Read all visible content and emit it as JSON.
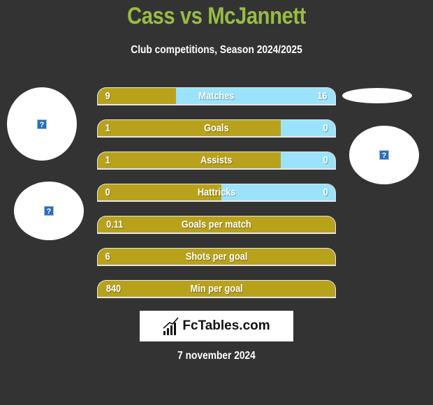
{
  "header": {
    "title": "Cass vs McJannett",
    "subtitle": "Club competitions, Season 2024/2025"
  },
  "colors": {
    "background": "#333333",
    "title": "#99bb44",
    "left_player": "#b8a21c",
    "right_player": "#9be3fb"
  },
  "stats": [
    {
      "label": "Matches",
      "left": "9",
      "right": "16",
      "right_share": 0.67
    },
    {
      "label": "Goals",
      "left": "1",
      "right": "0",
      "right_share": 0.23
    },
    {
      "label": "Assists",
      "left": "1",
      "right": "0",
      "right_share": 0.23
    },
    {
      "label": "Hattricks",
      "left": "0",
      "right": "0",
      "right_share": 0.48
    },
    {
      "label": "Goals per match",
      "left": "0.11",
      "right": null,
      "right_share": 0
    },
    {
      "label": "Shots per goal",
      "left": "6",
      "right": null,
      "right_share": 0
    },
    {
      "label": "Min per goal",
      "left": "840",
      "right": null,
      "right_share": 0
    }
  ],
  "avatars": {
    "icon": "broken-image-icon",
    "glyph": "?"
  },
  "footer": {
    "logo_text": "FcTables.com",
    "date": "7 november 2024"
  }
}
